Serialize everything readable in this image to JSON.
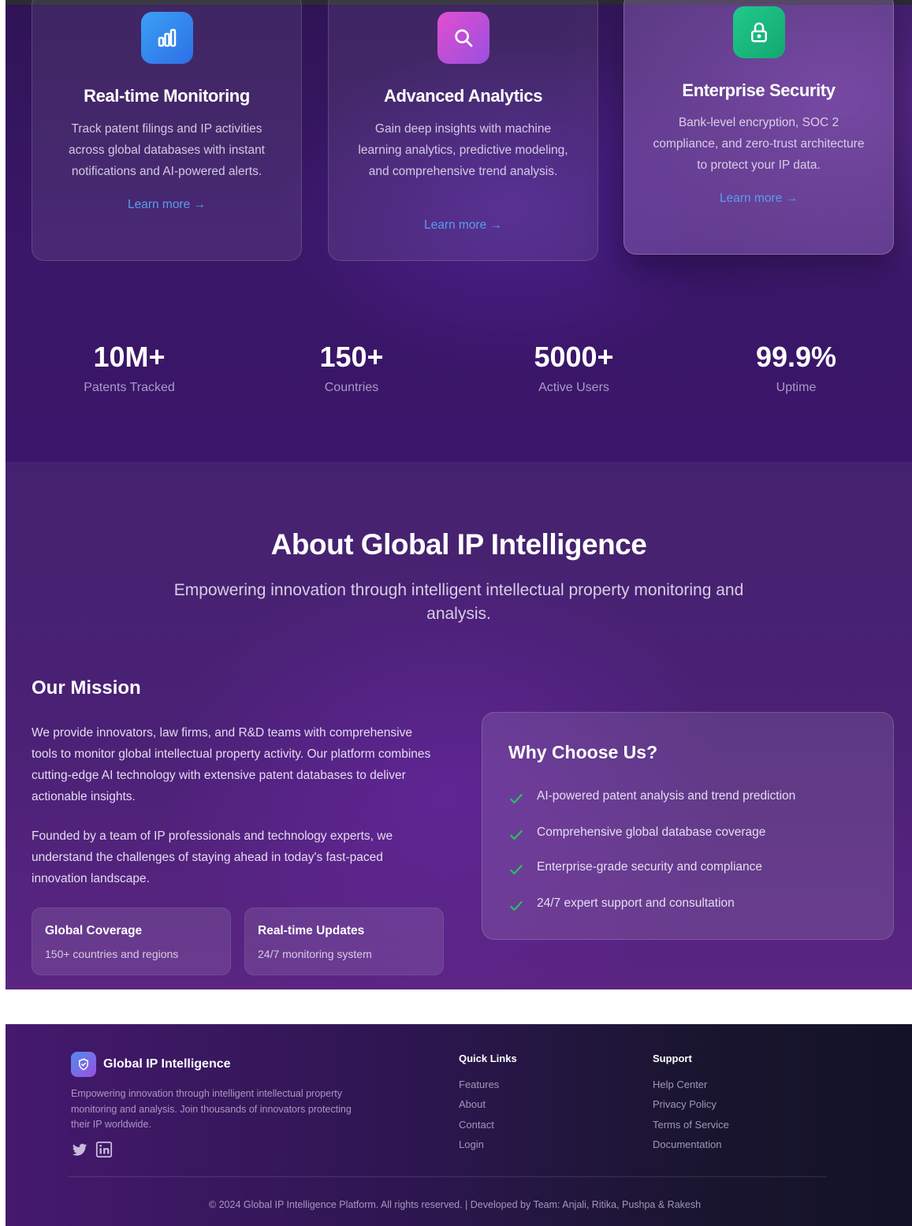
{
  "features": {
    "cards": [
      {
        "title": "Real-time Monitoring",
        "icon": "bar-chart-icon",
        "description": "Track patent filings and IP activities across global databases with instant notifications and AI-powered alerts.",
        "link": "Learn more →"
      },
      {
        "title": "Advanced Analytics",
        "icon": "search-icon",
        "description": "Gain deep insights with machine learning analytics, predictive modeling, and comprehensive trend analysis.",
        "link": "Learn more →"
      },
      {
        "title": "Enterprise Security",
        "icon": "lock-icon",
        "description": "Bank-level encryption, SOC 2 compliance, and zero-trust architecture to protect your IP data.",
        "link": "Learn more →"
      }
    ]
  },
  "stats": [
    {
      "value": "10M+",
      "label": "Patents Tracked"
    },
    {
      "value": "150+",
      "label": "Countries"
    },
    {
      "value": "5000+",
      "label": "Active Users"
    },
    {
      "value": "99.9%",
      "label": "Uptime"
    }
  ],
  "about": {
    "title": "About Global IP Intelligence",
    "subtitle": "Empowering innovation through intelligent intellectual property monitoring and analysis.",
    "mission_title": "Our Mission",
    "mission_p1": "We provide innovators, law firms, and R&D teams with comprehensive tools to monitor global intellectual property activity. Our platform combines cutting-edge AI technology with extensive patent databases to deliver actionable insights.",
    "mission_p2": "Founded by a team of IP professionals and technology experts, we understand the challenges of staying ahead in today's fast-paced innovation landscape.",
    "highlights": [
      {
        "title": "Global Coverage",
        "subtitle": "150+ countries and regions"
      },
      {
        "title": "Real-time Updates",
        "subtitle": "24/7 monitoring system"
      }
    ],
    "why": {
      "title": "Why Choose Us?",
      "items": [
        "AI-powered patent analysis and trend prediction",
        "Comprehensive global database coverage",
        "Enterprise-grade security and compliance",
        "24/7 expert support and consultation"
      ]
    }
  },
  "footer": {
    "brand": "Global IP Intelligence",
    "description": "Empowering innovation through intelligent intellectual property monitoring and analysis. Join thousands of innovators protecting their IP worldwide.",
    "quick_links": {
      "heading": "Quick Links",
      "links": [
        "Features",
        "About",
        "Contact",
        "Login"
      ]
    },
    "support": {
      "heading": "Support",
      "links": [
        "Help Center",
        "Privacy Policy",
        "Terms of Service",
        "Documentation"
      ]
    },
    "copyright": "© 2024 Global IP Intelligence Platform. All rights reserved. | Developed by Team: Anjali, Ritika, Pushpa & Rakesh"
  },
  "colors": {
    "accent_link": "#5b9cf2",
    "check_green": "#22c55e",
    "icon_blue": "#2d6fe6",
    "icon_pink": "#c14fd8",
    "icon_green": "#13a870"
  }
}
